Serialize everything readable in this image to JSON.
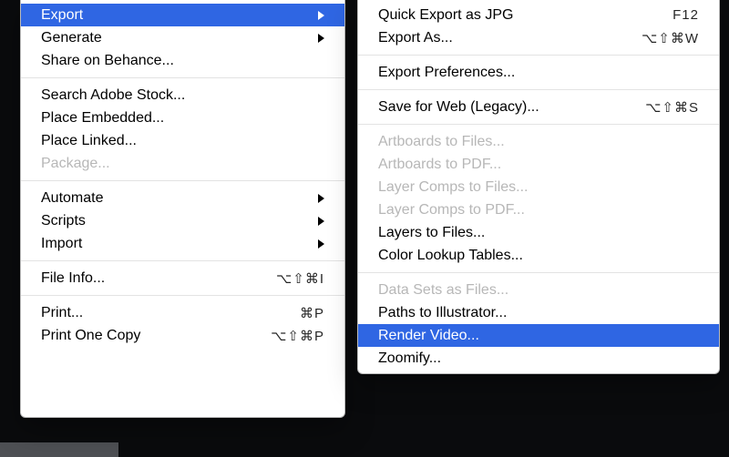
{
  "primary": {
    "export": "Export",
    "generate": "Generate",
    "share_behance": "Share on Behance...",
    "search_stock": "Search Adobe Stock...",
    "place_embedded": "Place Embedded...",
    "place_linked": "Place Linked...",
    "package": "Package...",
    "automate": "Automate",
    "scripts": "Scripts",
    "import": "Import",
    "file_info": "File Info...",
    "file_info_sc": "⌥⇧⌘I",
    "print": "Print...",
    "print_sc": "⌘P",
    "print_one": "Print One Copy",
    "print_one_sc": "⌥⇧⌘P"
  },
  "sub": {
    "quick_export": "Quick Export as JPG",
    "quick_export_sc": "F12",
    "export_as": "Export As...",
    "export_as_sc": "⌥⇧⌘W",
    "export_prefs": "Export Preferences...",
    "save_web": "Save for Web (Legacy)...",
    "save_web_sc": "⌥⇧⌘S",
    "artboards_files": "Artboards to Files...",
    "artboards_pdf": "Artboards to PDF...",
    "layer_comps_files": "Layer Comps to Files...",
    "layer_comps_pdf": "Layer Comps to PDF...",
    "layers_files": "Layers to Files...",
    "color_lookup": "Color Lookup Tables...",
    "data_sets": "Data Sets as Files...",
    "paths_illustrator": "Paths to Illustrator...",
    "render_video": "Render Video...",
    "zoomify": "Zoomify..."
  }
}
